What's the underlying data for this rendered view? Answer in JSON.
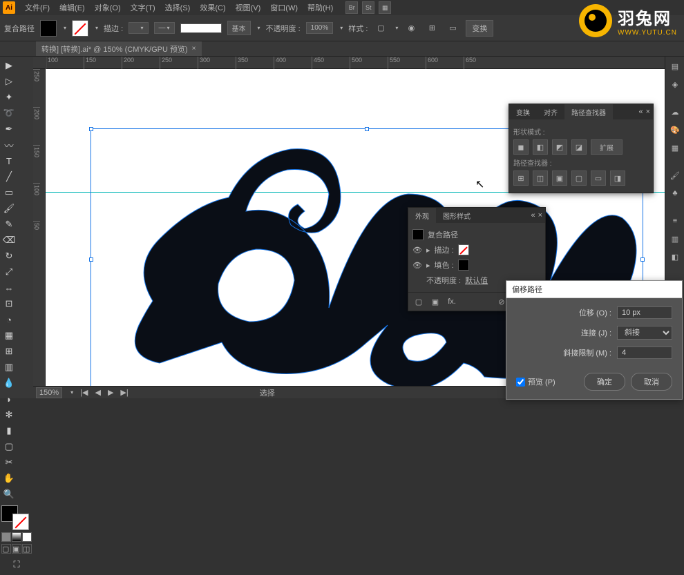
{
  "menu": {
    "file": "文件(F)",
    "edit": "编辑(E)",
    "object": "对象(O)",
    "type": "文字(T)",
    "select": "选择(S)",
    "effect": "效果(C)",
    "view": "视图(V)",
    "window": "窗口(W)",
    "help": "帮助(H)"
  },
  "header_icons": {
    "br": "Br",
    "st": "St"
  },
  "control": {
    "object_label": "复合路径",
    "stroke_label": "描边 :",
    "stroke_style": "基本",
    "opacity_label": "不透明度 :",
    "opacity_value": "100%",
    "style_label": "样式 :",
    "transform_btn": "变换"
  },
  "tab": {
    "name": "转换] [转换].ai* @ 150% (CMYK/GPU 预览)",
    "close": "×"
  },
  "ruler_h": [
    "100",
    "150",
    "200",
    "250",
    "300",
    "350",
    "400",
    "450",
    "500",
    "550",
    "600",
    "650"
  ],
  "ruler_v": [
    "250",
    "200",
    "150",
    "100",
    "50"
  ],
  "status": {
    "zoom": "150%",
    "mode": "选择"
  },
  "pathfinder": {
    "tab_transform": "变换",
    "tab_align": "对齐",
    "tab_pathfinder": "路径查找器",
    "shape_modes": "形状模式 :",
    "expand": "扩展",
    "pathfinders": "路径查找器 :"
  },
  "appearance": {
    "tab_appearance": "外观",
    "tab_graphic": "图形样式",
    "compound_path": "复合路径",
    "stroke": "描边 :",
    "fill": "填色 :",
    "opacity": "不透明度 :",
    "opacity_value": "默认值",
    "fx": "fx."
  },
  "offset_dialog": {
    "title": "偏移路径",
    "offset_label": "位移 (O) :",
    "offset_value": "10 px",
    "join_label": "连接 (J) :",
    "join_value": "斜接",
    "miter_label": "斜接限制 (M) :",
    "miter_value": "4",
    "preview": "预览 (P)",
    "ok": "确定",
    "cancel": "取消"
  },
  "logo": {
    "title": "羽兔网",
    "sub": "WWW.YUTU.CN"
  }
}
